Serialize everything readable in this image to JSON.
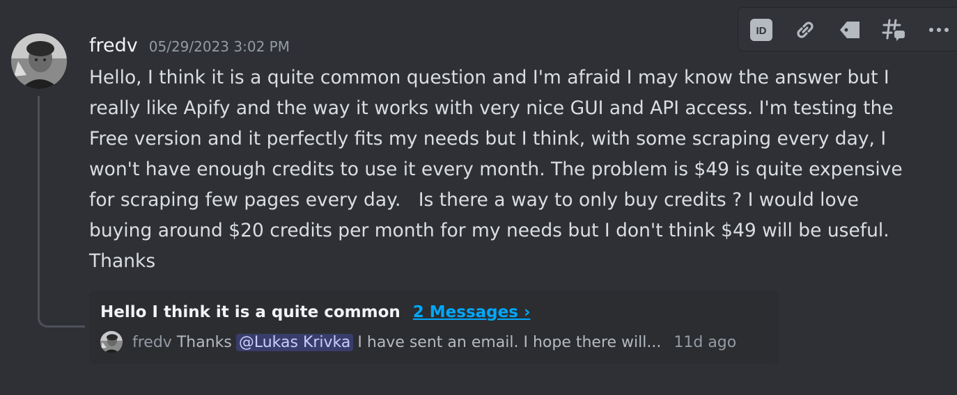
{
  "message": {
    "username": "fredv",
    "timestamp": "05/29/2023 3:02 PM",
    "content_lines": [
      "Hello, I think it is a quite common question and I'm afraid I may know the answer but I",
      "really like Apify and the way it works with very nice GUI and API access. I'm testing the",
      "Free version and it perfectly fits my needs but I think, with some scraping every day, I",
      "won't have enough credits to use it every month. The problem is $49 is quite expensive",
      "for scraping few pages every day.   Is there a way to only buy credits ? I would love",
      "buying around $20 credits per month for my needs but I don't think $49 will be useful.",
      "Thanks"
    ]
  },
  "thread": {
    "name": "Hello I think it is a quite common",
    "count": "2 Messages ›",
    "preview_user": "fredv",
    "preview_before": "Thanks",
    "preview_mention": "@Lukas Krivka",
    "preview_after": "I have sent an email. I hope there will...",
    "preview_time": "11d ago"
  },
  "toolbar": {
    "icons": [
      "id-icon",
      "link-icon",
      "tag-icon",
      "thread-icon",
      "more-icon"
    ],
    "id_glyph": "ID"
  },
  "colors": {
    "background": "#313338",
    "mention_bg": "#3c4270",
    "link": "#00a8fc"
  }
}
